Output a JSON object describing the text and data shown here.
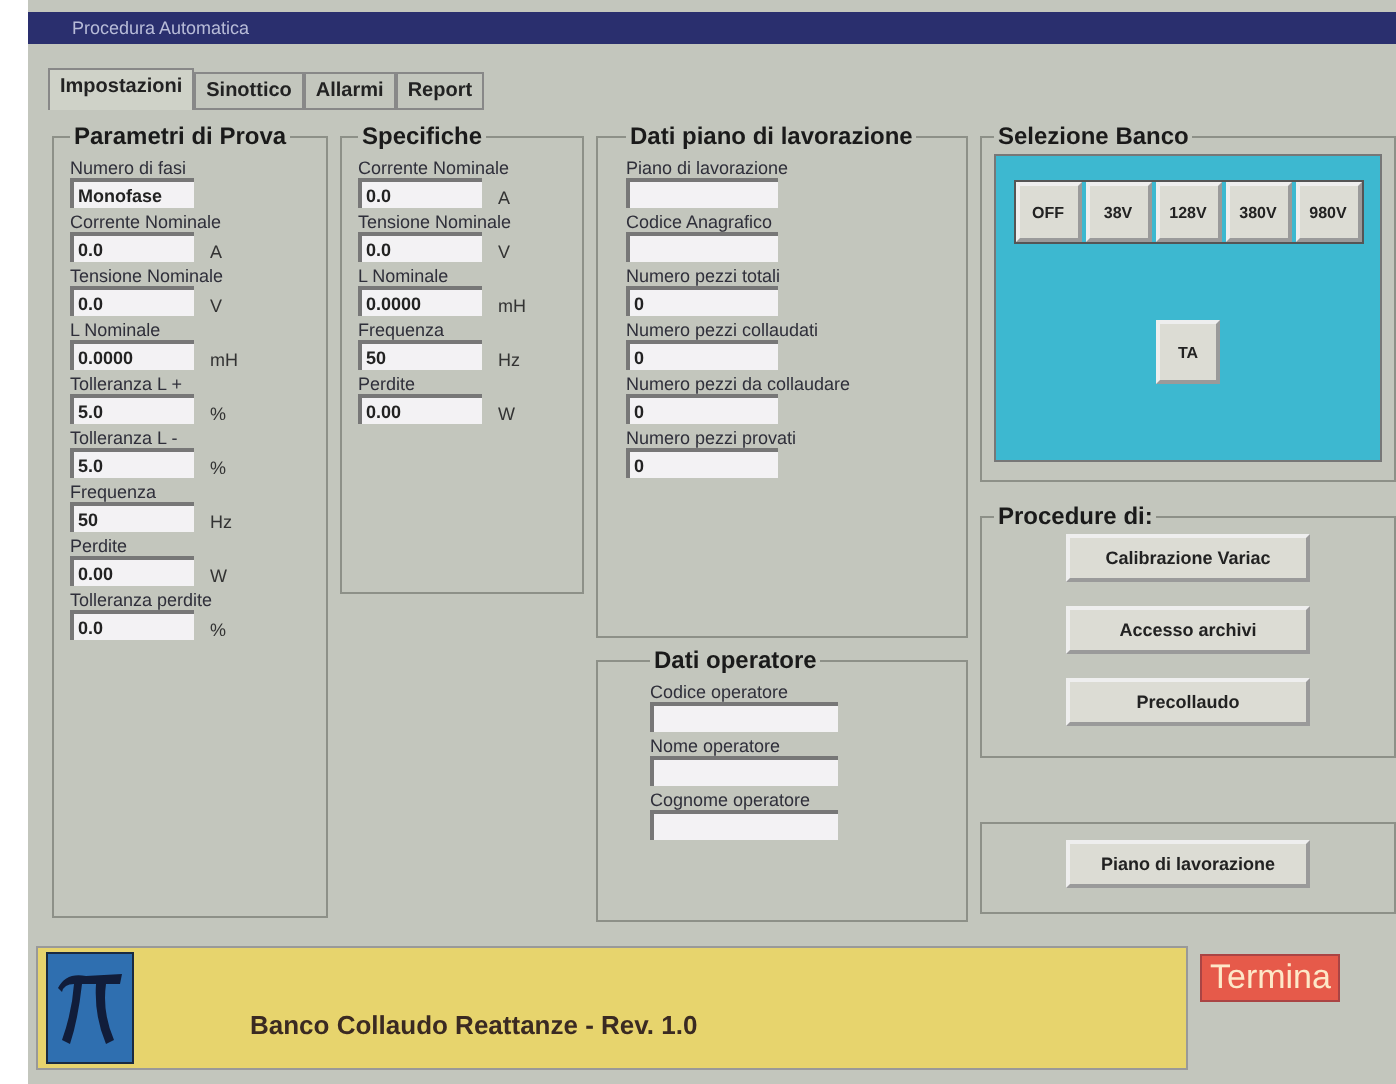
{
  "window": {
    "title": "Procedura Automatica"
  },
  "tabs": [
    {
      "label": "Impostazioni",
      "selected": true
    },
    {
      "label": "Sinottico",
      "selected": false
    },
    {
      "label": "Allarmi",
      "selected": false
    },
    {
      "label": "Report",
      "selected": false
    }
  ],
  "parametri": {
    "title": "Parametri di Prova",
    "fields": [
      {
        "label": "Numero di fasi",
        "value": "Monofase"
      },
      {
        "label": "Corrente Nominale",
        "value": "0.0",
        "unit": "A"
      },
      {
        "label": "Tensione Nominale",
        "value": "0.0",
        "unit": "V"
      },
      {
        "label": "L Nominale",
        "value": "0.0000",
        "unit": "mH"
      },
      {
        "label": "Tolleranza L +",
        "value": "5.0",
        "unit": "%"
      },
      {
        "label": "Tolleranza L -",
        "value": "5.0",
        "unit": "%"
      },
      {
        "label": "Frequenza",
        "value": "50",
        "unit": "Hz"
      },
      {
        "label": "Perdite",
        "value": "0.00",
        "unit": "W"
      },
      {
        "label": "Tolleranza perdite",
        "value": "0.0",
        "unit": "%"
      }
    ]
  },
  "specifiche": {
    "title": "Specifiche",
    "fields": [
      {
        "label": "Corrente Nominale",
        "value": "0.0",
        "unit": "A"
      },
      {
        "label": "Tensione Nominale",
        "value": "0.0",
        "unit": "V"
      },
      {
        "label": "L Nominale",
        "value": "0.0000",
        "unit": "mH"
      },
      {
        "label": "Frequenza",
        "value": "50",
        "unit": "Hz"
      },
      {
        "label": "Perdite",
        "value": "0.00",
        "unit": "W"
      }
    ]
  },
  "piano": {
    "title": "Dati piano di lavorazione",
    "fields": [
      {
        "label": "Piano di lavorazione"
      },
      {
        "label": "Codice Anagrafico"
      },
      {
        "label": "Numero pezzi totali",
        "value": "0"
      },
      {
        "label": "Numero pezzi collaudati",
        "value": "0"
      },
      {
        "label": "Numero pezzi da collaudare",
        "value": "0"
      },
      {
        "label": "Numero pezzi provati",
        "value": "0"
      }
    ]
  },
  "operatore": {
    "title": "Dati operatore",
    "fields": [
      {
        "label": "Codice operatore"
      },
      {
        "label": "Nome operatore"
      },
      {
        "label": "Cognome operatore"
      }
    ]
  },
  "banco": {
    "title": "Selezione Banco",
    "buttons": [
      "OFF",
      "38V",
      "128V",
      "380V",
      "980V"
    ],
    "extra": "TA"
  },
  "procedure": {
    "title": "Procedure di:",
    "buttons": [
      "Calibrazione Variac",
      "Accesso archivi",
      "Precollaudo"
    ]
  },
  "piano_button": "Piano di lavorazione",
  "footer": {
    "title": "Banco Collaudo Reattanze - Rev. 1.0",
    "exit": "Termina"
  }
}
